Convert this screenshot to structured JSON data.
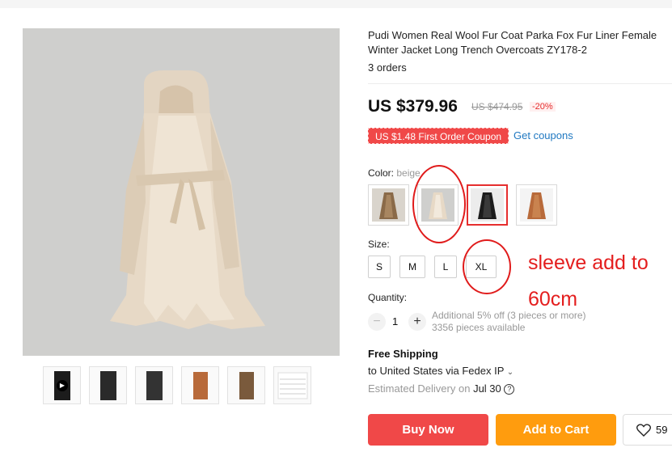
{
  "product": {
    "title": "Pudi Women Real Wool Fur Coat Parka Fox Fur Liner Female Winter Jacket Long Trench Overcoats ZY178-2",
    "orders": "3 orders"
  },
  "price": {
    "current": "US $379.96",
    "original": "US $474.95",
    "discount": "-20%"
  },
  "coupon": {
    "badge": "US $1.48 First Order Coupon",
    "link": "Get coupons"
  },
  "color": {
    "label": "Color:",
    "value": "beige",
    "options": [
      "camel",
      "beige",
      "black",
      "brown"
    ],
    "selected_index": 2
  },
  "size": {
    "label": "Size:",
    "options": [
      "S",
      "M",
      "L",
      "XL"
    ]
  },
  "quantity": {
    "label": "Quantity:",
    "minus": "−",
    "plus": "+",
    "value": "1",
    "note": "Additional 5% off (3 pieces or more)",
    "available": "3356 pieces available"
  },
  "shipping": {
    "title": "Free Shipping",
    "destination": "to United States via Fedex IP",
    "delivery_label": "Estimated Delivery on",
    "delivery_date": "Jul 30"
  },
  "buttons": {
    "buy_now": "Buy Now",
    "add_to_cart": "Add to Cart",
    "wishlist_count": "59"
  },
  "annotation": {
    "line1": "sleeve add to",
    "line2": "60cm"
  },
  "gallery": {
    "thumbnail_colors": [
      "#1c1c1c",
      "#2a2a2a",
      "#333333",
      "#b86a3a",
      "#7a5a3c",
      "#e8e8e8"
    ]
  },
  "colors": {
    "accent_red": "#f04848",
    "add_to_cart_orange": "#ff9c0e",
    "link_blue": "#1f78c1",
    "coat_beige": "#e7d9c6"
  }
}
